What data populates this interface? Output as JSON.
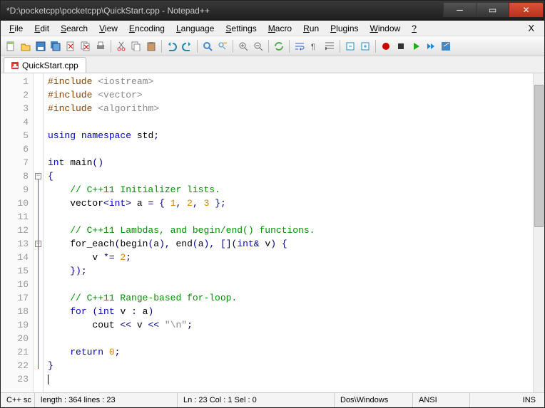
{
  "title": "*D:\\pocketcpp\\pocketcpp\\QuickStart.cpp - Notepad++",
  "menus": [
    "File",
    "Edit",
    "Search",
    "View",
    "Encoding",
    "Language",
    "Settings",
    "Macro",
    "Run",
    "Plugins",
    "Window",
    "?"
  ],
  "plugin_btn": "X",
  "tab": {
    "name": "QuickStart.cpp"
  },
  "code": {
    "lines": [
      {
        "n": 1,
        "html": "<span class='pre'>#include</span> <span class='str'>&lt;iostream&gt;</span>"
      },
      {
        "n": 2,
        "html": "<span class='pre'>#include</span> <span class='str'>&lt;vector&gt;</span>"
      },
      {
        "n": 3,
        "html": "<span class='pre'>#include</span> <span class='str'>&lt;algorithm&gt;</span>"
      },
      {
        "n": 4,
        "html": ""
      },
      {
        "n": 5,
        "html": "<span class='kw'>using</span> <span class='kw'>namespace</span> std<span class='op'>;</span>"
      },
      {
        "n": 6,
        "html": ""
      },
      {
        "n": 7,
        "html": "<span class='kw'>int</span> main<span class='op'>()</span>"
      },
      {
        "n": 8,
        "html": "<span class='op'>{</span>"
      },
      {
        "n": 9,
        "html": "    <span class='cmt'>// C++11 Initializer lists.</span>"
      },
      {
        "n": 10,
        "html": "    vector<span class='op'>&lt;</span><span class='kw'>int</span><span class='op'>&gt;</span> a <span class='op'>=</span> <span class='op'>{</span> <span class='num'>1</span><span class='op'>,</span> <span class='num'>2</span><span class='op'>,</span> <span class='num'>3</span> <span class='op'>};</span>"
      },
      {
        "n": 11,
        "html": ""
      },
      {
        "n": 12,
        "html": "    <span class='cmt'>// C++11 Lambdas, and begin/end() functions.</span>"
      },
      {
        "n": 13,
        "html": "    for_each<span class='op'>(</span>begin<span class='op'>(</span>a<span class='op'>),</span> end<span class='op'>(</span>a<span class='op'>),</span> <span class='op'>[](</span><span class='kw'>int</span><span class='op'>&amp;</span> v<span class='op'>)</span> <span class='op'>{</span>"
      },
      {
        "n": 14,
        "html": "        v <span class='op'>*=</span> <span class='num'>2</span><span class='op'>;</span>"
      },
      {
        "n": 15,
        "html": "    <span class='op'>});</span>"
      },
      {
        "n": 16,
        "html": ""
      },
      {
        "n": 17,
        "html": "    <span class='cmt'>// C++11 Range-based for-loop.</span>"
      },
      {
        "n": 18,
        "html": "    <span class='kw'>for</span> <span class='op'>(</span><span class='kw'>int</span> v <span class='op'>:</span> a<span class='op'>)</span>"
      },
      {
        "n": 19,
        "html": "        cout <span class='op'>&lt;&lt;</span> v <span class='op'>&lt;&lt;</span> <span class='str'>\"\\n\"</span><span class='op'>;</span>"
      },
      {
        "n": 20,
        "html": ""
      },
      {
        "n": 21,
        "html": "    <span class='kw'>return</span> <span class='num'>0</span><span class='op'>;</span>"
      },
      {
        "n": 22,
        "html": "<span class='op'>}</span>"
      },
      {
        "n": 23,
        "html": "<span class='cursor'></span>"
      }
    ]
  },
  "folds": [
    {
      "line": 8,
      "type": "box"
    },
    {
      "line": 13,
      "type": "box"
    }
  ],
  "status": {
    "lang": "C++ sc",
    "length_lines": "length : 364    lines : 23",
    "pos": "Ln : 23   Col : 1   Sel : 0",
    "eol": "Dos\\Windows",
    "enc": "ANSI",
    "mode": "INS"
  },
  "toolbar_icons": [
    "new",
    "open",
    "save",
    "saveall",
    "close",
    "closeall",
    "print",
    "",
    "cut",
    "copy",
    "paste",
    "",
    "undo",
    "redo",
    "",
    "find",
    "replace",
    "",
    "zoomin",
    "zoomout",
    "",
    "sync",
    "",
    "wordwrap",
    "allchars",
    "indent",
    "",
    "foldall",
    "unfoldall",
    "",
    "record",
    "stop",
    "play",
    "fastplay",
    "savemacro"
  ]
}
